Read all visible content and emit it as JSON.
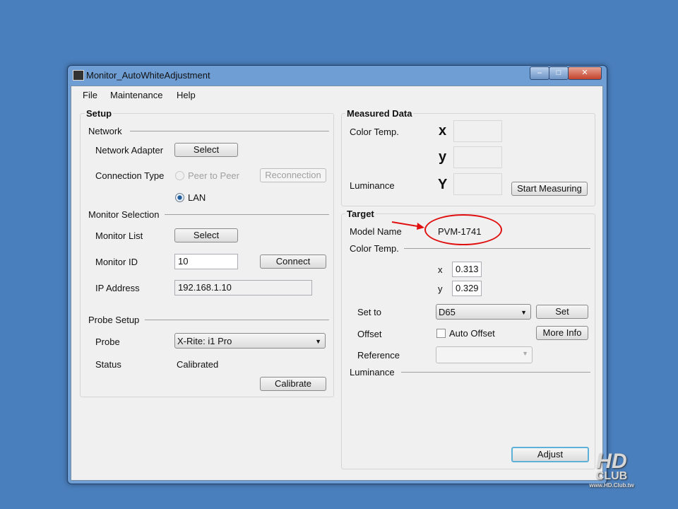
{
  "window": {
    "title": "Monitor_AutoWhiteAdjustment"
  },
  "menu": [
    "File",
    "Maintenance",
    "Help"
  ],
  "setup": {
    "title": "Setup",
    "network": {
      "label": "Network",
      "adapter_label": "Network Adapter",
      "adapter_button": "Select",
      "conn_label": "Connection Type",
      "peer": "Peer to Peer",
      "lan": "LAN",
      "lan_selected": true,
      "reconnect": "Reconnection"
    },
    "monitor": {
      "label": "Monitor Selection",
      "list_label": "Monitor List",
      "list_button": "Select",
      "id_label": "Monitor ID",
      "id_value": "10",
      "connect": "Connect",
      "ip_label": "IP Address",
      "ip_value": "192.168.1.10"
    },
    "probe": {
      "label": "Probe Setup",
      "probe_label": "Probe",
      "probe_value": "X-Rite: i1 Pro",
      "status_label": "Status",
      "status_value": "Calibrated",
      "calibrate": "Calibrate"
    }
  },
  "measured": {
    "title": "Measured Data",
    "color_temp": "Color Temp.",
    "x": "x",
    "y": "y",
    "Y": "Y",
    "luminance": "Luminance",
    "start": "Start Measuring"
  },
  "target": {
    "title": "Target",
    "model_label": "Model Name",
    "model_value": "PVM-1741",
    "color_temp": "Color Temp.",
    "x_label": "x",
    "x_value": "0.313",
    "y_label": "y",
    "y_value": "0.329",
    "setto_label": "Set to",
    "setto_value": "D65",
    "set": "Set",
    "offset_label": "Offset",
    "auto_offset": "Auto Offset",
    "more_info": "More Info",
    "reference_label": "Reference",
    "luminance": "Luminance",
    "adjust": "Adjust"
  },
  "annotation_color": "#e01010",
  "watermark": {
    "text": "HD CLUB",
    "url": "www.HD.Club.tw"
  }
}
